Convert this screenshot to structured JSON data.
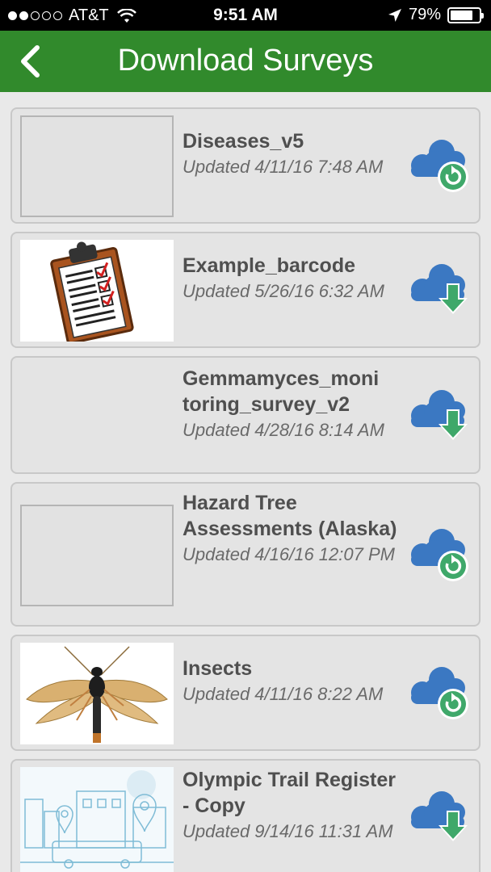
{
  "status_bar": {
    "signal_dots_filled": 2,
    "signal_dots_total": 5,
    "carrier": "AT&T",
    "time": "9:51 AM",
    "battery_percent_text": "79%",
    "battery_level": 0.79,
    "icons": [
      "wifi-icon",
      "location-arrow-icon",
      "battery-icon"
    ]
  },
  "nav": {
    "title": "Download Surveys",
    "back_icon": "chevron-left-icon"
  },
  "colors": {
    "nav_green": "#318a2c",
    "cloud_blue": "#3b78c2",
    "action_green": "#3fa86a"
  },
  "surveys": [
    {
      "title": "Diseases_v5",
      "updated": "Updated 4/11/16 7:48 AM",
      "thumbnail": "blank",
      "action": "refresh"
    },
    {
      "title": "Example_barcode",
      "updated": "Updated 5/26/16 6:32 AM",
      "thumbnail": "clipboard-checklist",
      "action": "download"
    },
    {
      "title": "Gemmamyces_monitoring_survey_v2",
      "updated": "Updated 4/28/16 8:14 AM",
      "thumbnail": "none",
      "action": "download"
    },
    {
      "title": "Hazard Tree Assessments (Alaska)",
      "updated": "Updated 4/16/16 12:07 PM",
      "thumbnail": "blank",
      "action": "refresh"
    },
    {
      "title": "Insects",
      "updated": "Updated 4/11/16 8:22 AM",
      "thumbnail": "insect-photo",
      "action": "refresh"
    },
    {
      "title": "Olympic Trail Register - Copy",
      "updated": "Updated 9/14/16 11:31 AM",
      "thumbnail": "city-map-illustration",
      "action": "download"
    }
  ]
}
